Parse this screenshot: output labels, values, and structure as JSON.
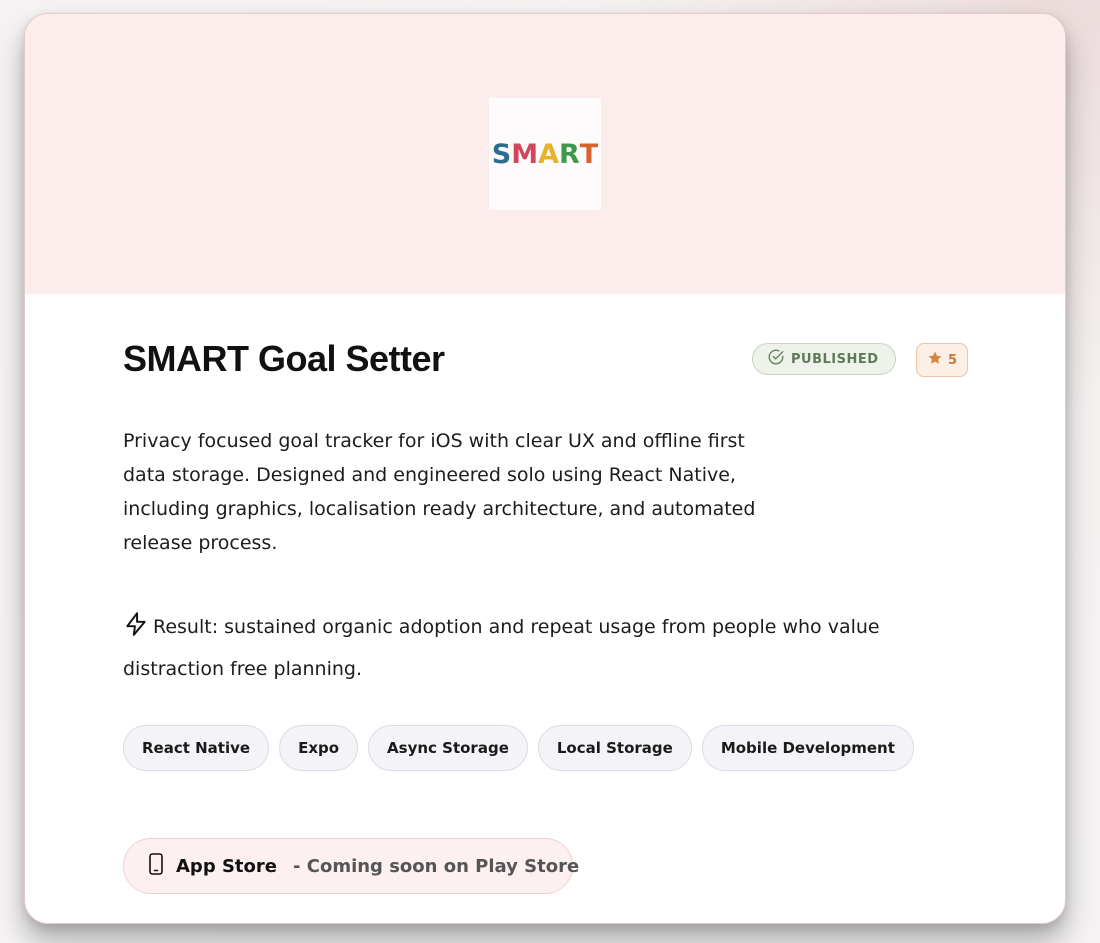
{
  "logo": {
    "letters": [
      {
        "char": "S",
        "color": "#2a6f8f"
      },
      {
        "char": "M",
        "color": "#d2455c"
      },
      {
        "char": "A",
        "color": "#e9b22d"
      },
      {
        "char": "R",
        "color": "#3e9a4a"
      },
      {
        "char": "T",
        "color": "#d7642c"
      }
    ],
    "icon": "smart-logo-icon"
  },
  "project": {
    "title": "SMART Goal Setter",
    "status": "PUBLISHED",
    "status_icon": "check-circle-icon",
    "rating": "5",
    "rating_icon": "star-icon",
    "description": "Privacy focused goal tracker for iOS with clear UX and offline first data storage. Designed and engineered solo using React Native, including graphics, localisation ready architecture, and automated release process.",
    "result_icon": "lightning-icon",
    "result": "Result: sustained organic adoption and repeat usage from people who value distraction free planning."
  },
  "tags": [
    "React Native",
    "Expo",
    "Async Storage",
    "Local Storage",
    "Mobile Development"
  ],
  "store": {
    "icon": "smartphone-icon",
    "name": "App Store",
    "note": "- Coming soon on Play Store"
  },
  "colors": {
    "hero_background": "#fcecec",
    "published_text": "#5f7a58",
    "rating_accent": "#c8793c"
  }
}
